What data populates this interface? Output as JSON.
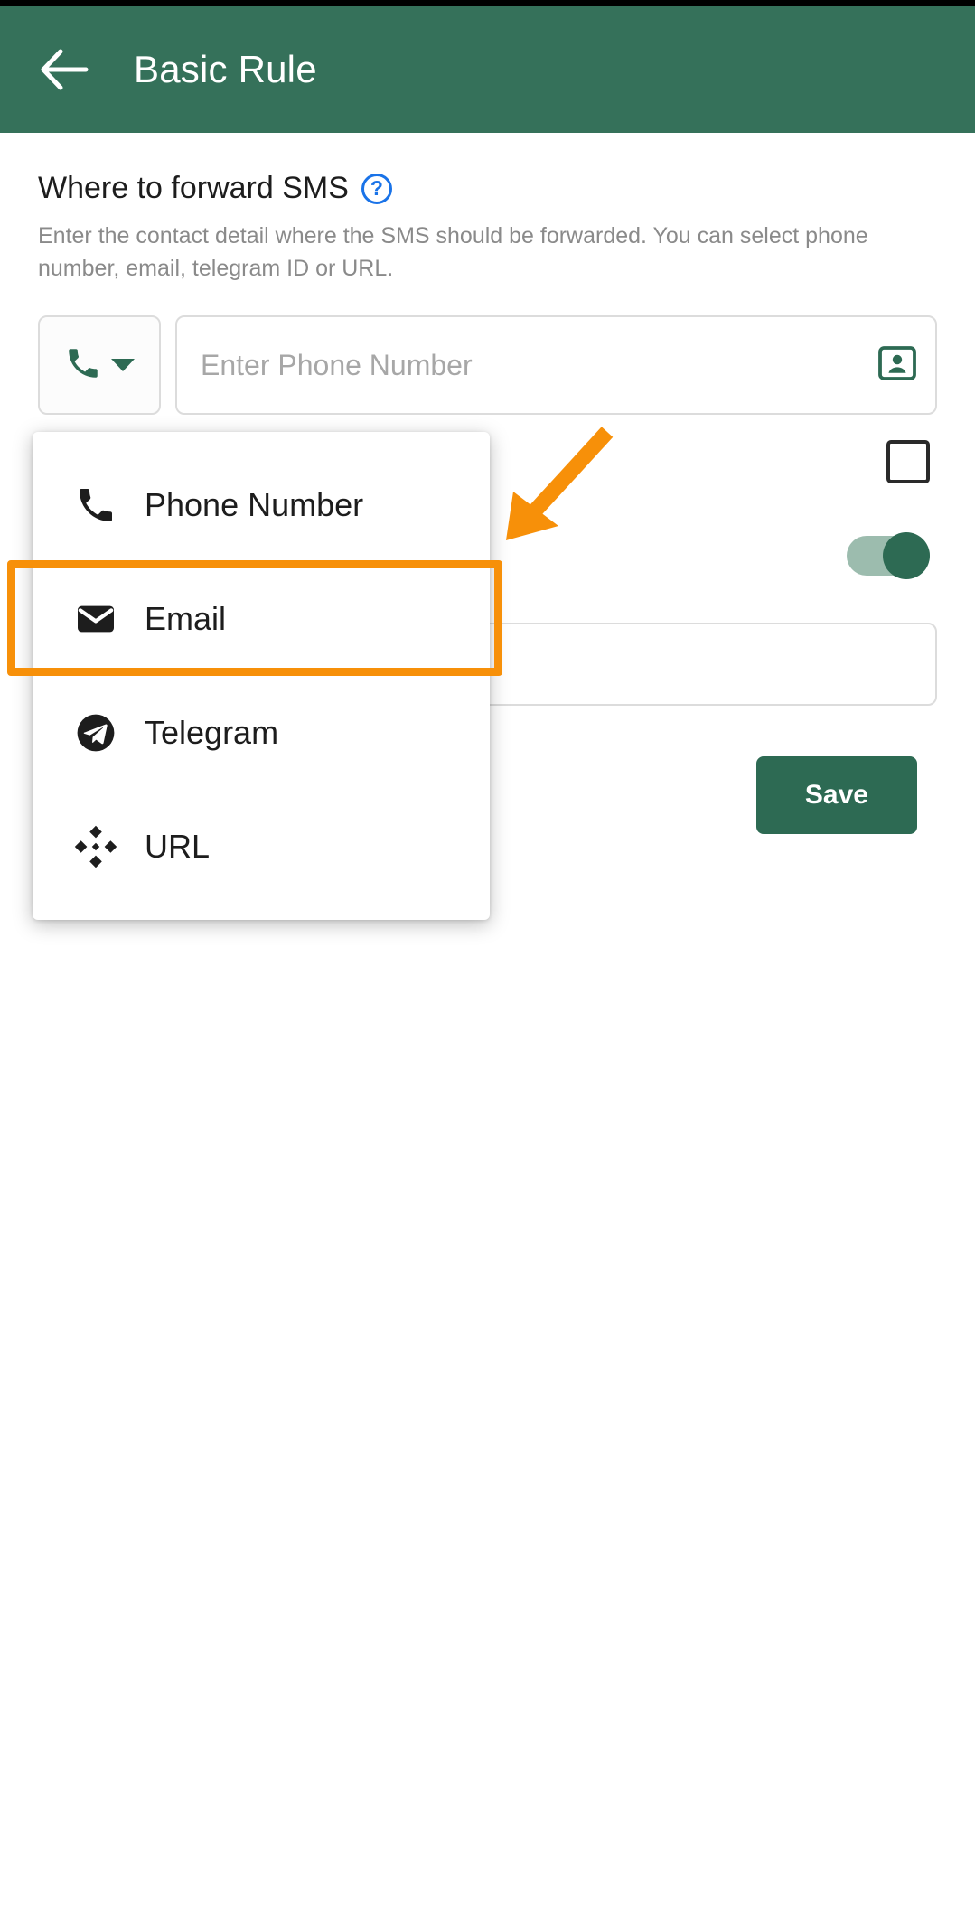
{
  "appbar": {
    "back_icon": "arrow-left-icon",
    "title": "Basic Rule",
    "background_color": "#35715A",
    "title_color": "#FFFFFF"
  },
  "section": {
    "title": "Where to forward SMS",
    "help_icon": "help-circle-icon",
    "help_glyph": "?",
    "help_color": "#1A73E8",
    "description": "Enter the contact detail where the SMS should be forwarded. You can select phone number, email, telegram ID or URL."
  },
  "input_row": {
    "type_selector": {
      "icon": "phone-icon",
      "icon_color": "#2D6A53",
      "caret_icon": "chevron-down-icon",
      "selected_value": "Phone Number"
    },
    "phone_field": {
      "value": "",
      "placeholder": "Enter Phone Number",
      "trailing_icon": "contact-card-icon",
      "trailing_icon_color": "#2D6A53"
    }
  },
  "controls": {
    "checkbox": {
      "icon": "checkbox-unchecked-icon",
      "checked": false
    },
    "toggle": {
      "icon": "toggle-switch-icon",
      "enabled": true,
      "track_color": "#9CBCAE",
      "knob_color": "#2D6A53"
    },
    "extra_field": {
      "value": "",
      "placeholder": ""
    }
  },
  "dropdown": {
    "open": true,
    "items": [
      {
        "label": "Phone Number",
        "icon": "phone-icon"
      },
      {
        "label": "Email",
        "icon": "envelope-icon"
      },
      {
        "label": "Telegram",
        "icon": "telegram-icon"
      },
      {
        "label": "URL",
        "icon": "url-diamond-icon"
      }
    ],
    "highlighted_index": 1
  },
  "save": {
    "label": "Save",
    "background_color": "#2D6A53",
    "text_color": "#FFFFFF"
  },
  "annotation": {
    "highlight_color": "#F79009",
    "arrow_icon": "arrow-pointer-icon",
    "target_label": "Email"
  }
}
